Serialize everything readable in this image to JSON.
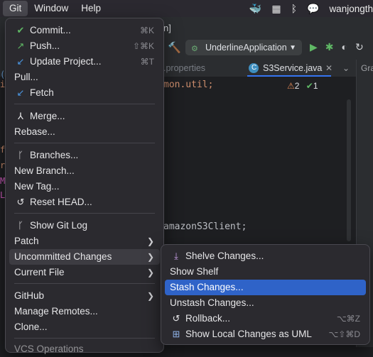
{
  "menubar": {
    "items": [
      "Git",
      "Window",
      "Help"
    ],
    "user": "wanjongth"
  },
  "ide": {
    "title_fragment": "n]",
    "run_config": "UnderlineApplication",
    "tabs": [
      ".properties",
      "S3Service.java"
    ],
    "right_panel_label": "Gra",
    "code_line_1": "mon.util;",
    "code_line_2": "amazonS3Client;",
    "warnings": "2",
    "checks": "1"
  },
  "git_menu": {
    "commit": {
      "label": "Commit...",
      "shortcut": "⌘K"
    },
    "push": {
      "label": "Push...",
      "shortcut": "⇧⌘K"
    },
    "update": {
      "label": "Update Project...",
      "shortcut": "⌘T"
    },
    "pull": "Pull...",
    "fetch": "Fetch",
    "merge": "Merge...",
    "rebase": "Rebase...",
    "branches": "Branches...",
    "new_branch": "New Branch...",
    "new_tag": "New Tag...",
    "reset_head": "Reset HEAD...",
    "show_git_log": "Show Git Log",
    "patch": "Patch",
    "uncommitted": "Uncommitted Changes",
    "current_file": "Current File",
    "github": "GitHub",
    "manage_remotes": "Manage Remotes...",
    "clone": "Clone...",
    "vcs_ops": "VCS Operations"
  },
  "submenu": {
    "shelve": "Shelve Changes...",
    "show_shelf": "Show Shelf",
    "stash": "Stash Changes...",
    "unstash": "Unstash Changes...",
    "rollback": {
      "label": "Rollback...",
      "shortcut": "⌥⌘Z"
    },
    "show_local": {
      "label": "Show Local Changes as UML",
      "shortcut": "⌥⇧⌘D"
    }
  }
}
